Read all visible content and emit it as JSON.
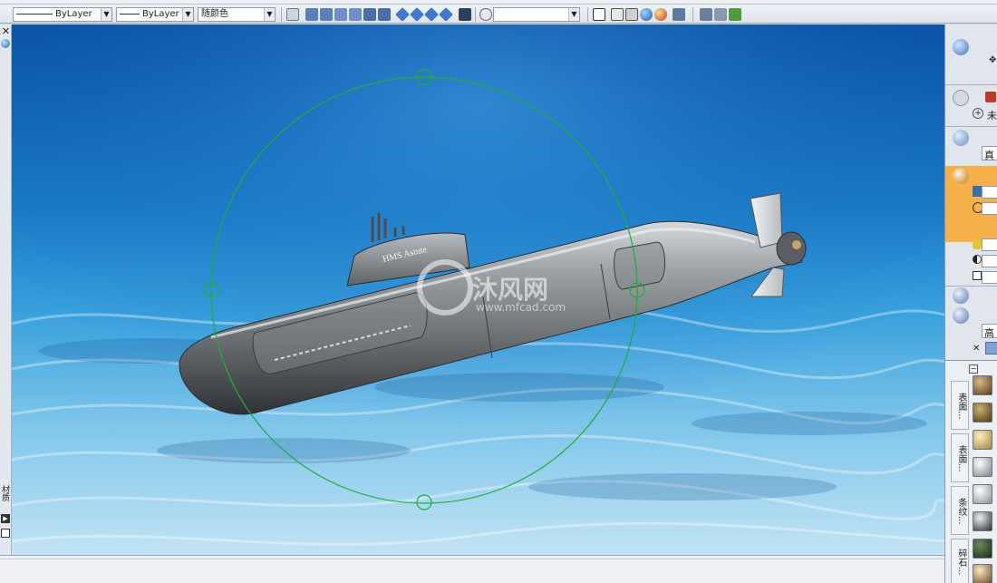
{
  "toolbar": {
    "linetype_combo": "ByLayer",
    "lineweight_combo": "ByLayer",
    "color_combo": "随颜色",
    "plot_style_combo": ""
  },
  "viewport": {
    "sail_label": "HMS Astute",
    "watermark_name": "沐风网",
    "watermark_url": "www.mfcad.com"
  },
  "left_palette": {
    "tab_label": "材质"
  },
  "right_panel": {
    "label_unnamed": "未",
    "label_real": "真",
    "label_high": "高",
    "material_tabs": [
      "表面...",
      "表面...",
      "条纹...",
      "碎石..."
    ],
    "material_trailing": "石"
  },
  "colors": {
    "water_top": "#0a5fb0",
    "water_mid": "#2a8fd6",
    "sand": "#b9dcef",
    "selection_ring": "#1fae3a",
    "hull": "#7a7f84"
  }
}
